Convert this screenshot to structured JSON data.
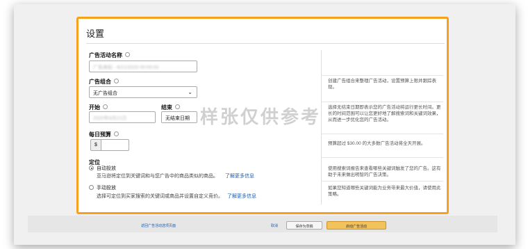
{
  "panel": {
    "title": "设置"
  },
  "campaign_name": {
    "label": "广告活动名称",
    "value": "广告商标 - 6/21/2020 00:00:00"
  },
  "ad_group": {
    "label": "广告组合",
    "value": "无广告组合",
    "help": "创建广告组合来整理广告活动，设置预算上限并跟踪表现。"
  },
  "start": {
    "label": "开始",
    "value": "2020年6月21日"
  },
  "end": {
    "label": "结束",
    "value": "无结束日期",
    "help": "选择无结束日期即表示您的广告活动将运行更长时间。更长的时间范围可以让您更好地了解搜索词和关键词效果，从而进一步优化您的广告活动。"
  },
  "daily_budget": {
    "label": "每日预算",
    "currency": "$",
    "value": "",
    "help": "预算超过 $30.00 的大多数广告活动将全天开展。"
  },
  "targeting": {
    "label": "定位",
    "auto": {
      "label": "自动投放",
      "desc": "亚马逊将定位到关键词和与您广告中的商品类似的商品。",
      "link": "了解更多信息",
      "help": "使用搜索词报告来查看哪些关键词触发了您的广告。这有助于未来做出明智的广告决策。"
    },
    "manual": {
      "label": "手动投放",
      "desc": "选择可定位到买家搜索的关键词或商品并设置自定义竞价。",
      "link": "了解更多信息",
      "help": "如果您知道哪些关键词能为业务带来最大价值，请使用此策略。"
    }
  },
  "watermark": "样张仅供参考",
  "footer": {
    "back": "返回广告活动选项页面",
    "cancel": "取消",
    "save_draft": "保存为草稿",
    "launch": "启动广告活动"
  }
}
